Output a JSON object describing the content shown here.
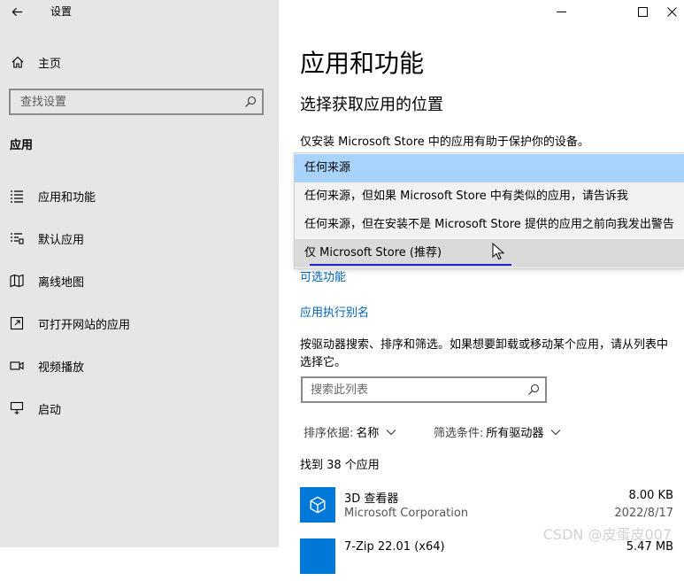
{
  "window": {
    "title": "设置",
    "controls": [
      "minimize",
      "maximize",
      "close"
    ]
  },
  "sidebar": {
    "home_label": "主页",
    "search_placeholder": "查找设置",
    "section_label": "应用",
    "items": [
      {
        "label": "应用和功能",
        "icon": "apps-list-icon"
      },
      {
        "label": "默认应用",
        "icon": "default-apps-icon"
      },
      {
        "label": "离线地图",
        "icon": "offline-map-icon"
      },
      {
        "label": "可打开网站的应用",
        "icon": "open-website-icon"
      },
      {
        "label": "视频播放",
        "icon": "video-icon"
      },
      {
        "label": "启动",
        "icon": "startup-icon"
      }
    ]
  },
  "main": {
    "title": "应用和功能",
    "subtitle": "选择获取应用的位置",
    "description": "仅安装 Microsoft Store 中的应用有助于保护你的设备。",
    "dropdown": {
      "selected": "仅 Microsoft Store (推荐)",
      "options": [
        "任何来源",
        "任何来源，但如果 Microsoft Store 中有类似的应用，请告诉我",
        "任何来源，但在安装不是 Microsoft Store 提供的应用之前向我发出警告",
        "仅 Microsoft Store (推荐)"
      ]
    },
    "links": {
      "optional_features": "可选功能",
      "app_aliases": "应用执行别名"
    },
    "instructions": "按驱动器搜索、排序和筛选。如果想要卸载或移动某个应用，请从列表中选择它。",
    "list_search_placeholder": "搜索此列表",
    "sort": {
      "label": "排序依据:",
      "value": "名称"
    },
    "filter": {
      "label": "筛选条件:",
      "value": "所有驱动器"
    },
    "count_text": "找到 38 个应用",
    "apps": [
      {
        "name": "3D 查看器",
        "publisher": "Microsoft Corporation",
        "size": "8.00 KB",
        "date": "2022/8/17"
      },
      {
        "name": "7-Zip 22.01 (x64)",
        "publisher": "",
        "size": "5.47 MB",
        "date": ""
      }
    ]
  },
  "watermark": "CSDN @皮蛋皮007",
  "colors": {
    "accent": "#0078d7",
    "link": "#0063b1",
    "selection": "#a8d4fb",
    "sidebar_bg": "#e6e6e6"
  }
}
